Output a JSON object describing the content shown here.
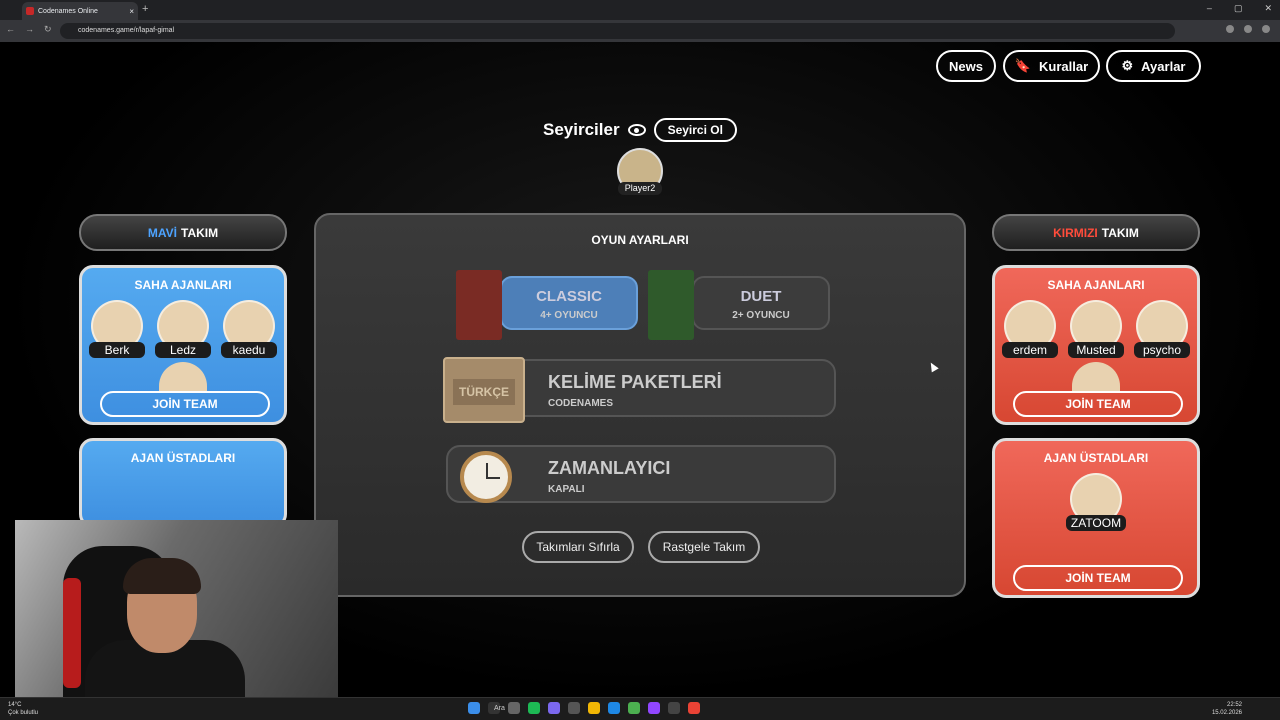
{
  "browser": {
    "tab_title": "Codenames Online",
    "url": "codenames.game/r/lapaf-gimal"
  },
  "header": {
    "news": "News",
    "rules": "Kurallar",
    "settings": "Ayarlar"
  },
  "spectators": {
    "title": "Seyirciler",
    "button": "Seyirci Ol",
    "player": "Player2"
  },
  "blue": {
    "team_word1": "MAVİ",
    "team_word2": "TAKIM",
    "operatives_title": "SAHA AJANLARI",
    "players": [
      "Berk",
      "Ledz",
      "kaedu"
    ],
    "join": "JOİN TEAM",
    "spymasters_title": "AJAN ÜSTADLARI"
  },
  "red": {
    "team_word1": "KIRMIZI",
    "team_word2": "TAKIM",
    "operatives_title": "SAHA AJANLARI",
    "players": [
      "erdem",
      "Musted",
      "psycho"
    ],
    "join": "JOİN TEAM",
    "spymasters_title": "AJAN ÜSTADLARI",
    "spymaster": "ZATOOM",
    "join2": "JOİN TEAM"
  },
  "settings": {
    "title": "OYUN AYARLARI",
    "classic": {
      "name": "CLASSIC",
      "players": "4+ OYUNCU"
    },
    "duet": {
      "name": "DUET",
      "players": "2+ OYUNCU"
    },
    "wordpacks": {
      "title": "KELİME PAKETLERİ",
      "value": "CODENAMES",
      "badge": "TÜRKÇE"
    },
    "timer": {
      "title": "ZAMANLAYICI",
      "value": "KAPALI"
    },
    "reset_teams": "Takımları Sıfırla",
    "random_teams": "Rastgele Takım"
  },
  "taskbar": {
    "search": "Ara",
    "temp": "14°C",
    "weather": "Çok bulutlu",
    "time": "22:52",
    "date": "15.02.2026"
  }
}
